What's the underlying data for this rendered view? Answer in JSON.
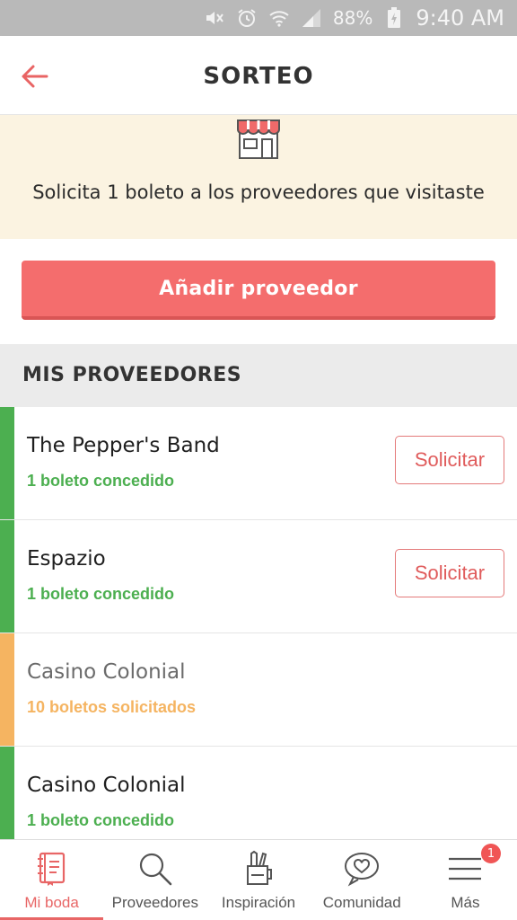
{
  "status_bar": {
    "battery": "88%",
    "time": "9:40 AM",
    "icons": [
      "mute-icon",
      "alarm-icon",
      "wifi-icon",
      "signal-icon",
      "battery-charging-icon"
    ]
  },
  "header": {
    "title": "SORTEO",
    "back_icon": "back-arrow-icon"
  },
  "banner": {
    "icon": "store-icon",
    "message": "Solicita 1 boleto a los proveedores que visitaste"
  },
  "add_button": {
    "label": "Añadir proveedor"
  },
  "section": {
    "title": "MIS PROVEEDORES"
  },
  "vendors": [
    {
      "name": "The Pepper's Band",
      "status": "1 boleto concedido",
      "state": "granted",
      "action": "Solicitar"
    },
    {
      "name": "Espazio",
      "status": "1 boleto concedido",
      "state": "granted",
      "action": "Solicitar"
    },
    {
      "name": "Casino Colonial",
      "status": "10 boletos solicitados",
      "state": "pending",
      "action": ""
    },
    {
      "name": "Casino Colonial",
      "status": "1 boleto concedido",
      "state": "granted",
      "action": ""
    }
  ],
  "bottom_nav": {
    "items": [
      {
        "label": "Mi boda",
        "icon": "notebook-icon",
        "active": true
      },
      {
        "label": "Proveedores",
        "icon": "search-icon",
        "active": false
      },
      {
        "label": "Inspiración",
        "icon": "pencil-cup-icon",
        "active": false
      },
      {
        "label": "Comunidad",
        "icon": "chat-heart-icon",
        "active": false
      },
      {
        "label": "Más",
        "icon": "menu-icon",
        "active": false,
        "badge": "1"
      }
    ]
  },
  "colors": {
    "accent": "#f46d6d",
    "granted": "#4caf50",
    "pending": "#f5b461",
    "banner_bg": "#fbf3e1",
    "section_bg": "#ebebeb"
  }
}
